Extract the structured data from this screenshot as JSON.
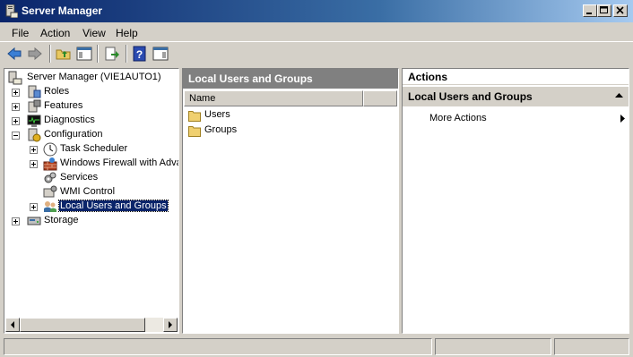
{
  "window": {
    "title": "Server Manager"
  },
  "menu": [
    "File",
    "Action",
    "View",
    "Help"
  ],
  "toolbar_icons": [
    "back-arrow-icon",
    "forward-arrow-icon",
    "up-folder-icon",
    "show-hide-tree-icon",
    "export-list-icon",
    "help-icon",
    "show-hide-action-pane-icon"
  ],
  "tree": {
    "root": "Server Manager (VIE1AUTO1)",
    "nodes": [
      {
        "label": "Roles",
        "expander": "+",
        "icon": "roles-icon"
      },
      {
        "label": "Features",
        "expander": "+",
        "icon": "features-icon"
      },
      {
        "label": "Diagnostics",
        "expander": "+",
        "icon": "diagnostics-icon"
      },
      {
        "label": "Configuration",
        "expander": "-",
        "icon": "configuration-icon"
      },
      {
        "label": "Task Scheduler",
        "expander": "+",
        "icon": "clock-icon"
      },
      {
        "label": "Windows Firewall with Adva",
        "expander": "+",
        "icon": "firewall-icon"
      },
      {
        "label": "Services",
        "expander": "",
        "icon": "gears-icon"
      },
      {
        "label": "WMI Control",
        "expander": "",
        "icon": "wmi-icon"
      },
      {
        "label": "Local Users and Groups",
        "expander": "+",
        "icon": "users-icon",
        "selected": true
      },
      {
        "label": "Storage",
        "expander": "+",
        "icon": "storage-icon"
      }
    ]
  },
  "middle": {
    "header": "Local Users and Groups",
    "column": "Name",
    "items": [
      "Users",
      "Groups"
    ]
  },
  "actions": {
    "title": "Actions",
    "section": "Local Users and Groups",
    "items": [
      "More Actions"
    ]
  },
  "colors": {
    "title_start": "#0a246a",
    "title_end": "#a6caf0",
    "selection": "#0a246a",
    "face": "#d4d0c8"
  }
}
